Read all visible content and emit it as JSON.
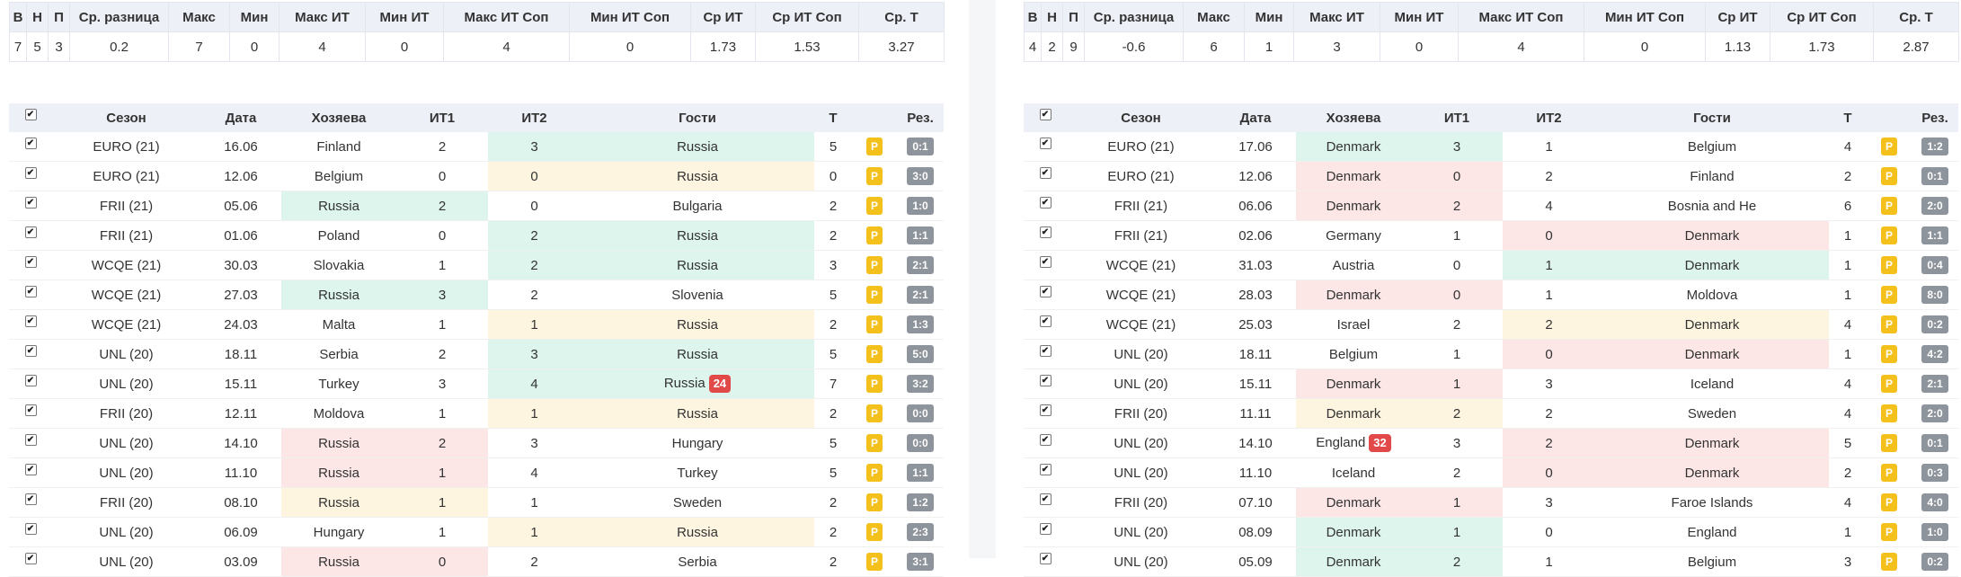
{
  "summary_headers": [
    "В",
    "Н",
    "П",
    "Ср. разница",
    "Макс",
    "Мин",
    "Макс ИТ",
    "Мин ИТ",
    "Макс ИТ Соп",
    "Мин ИТ Соп",
    "Ср ИТ",
    "Ср ИТ Соп",
    "Ср. Т"
  ],
  "match_headers": [
    "Сезон",
    "Дата",
    "Хозяева",
    "ИТ1",
    "ИТ2",
    "Гости",
    "Т",
    "Рез."
  ],
  "check_mark": "✔",
  "p_label": "P",
  "left": {
    "summary": [
      "7",
      "5",
      "3",
      "0.2",
      "7",
      "0",
      "4",
      "0",
      "4",
      "0",
      "1.73",
      "1.53",
      "3.27"
    ],
    "rows": [
      {
        "season": "EURO (21)",
        "date": "16.06",
        "home": "Finland",
        "it1": "2",
        "it2": "3",
        "away": "Russia",
        "t": "5",
        "res": "0:1",
        "hl": "away",
        "hc": "g"
      },
      {
        "season": "EURO (21)",
        "date": "12.06",
        "home": "Belgium",
        "it1": "0",
        "it2": "0",
        "away": "Russia",
        "t": "0",
        "res": "3:0",
        "hl": "away",
        "hc": "y"
      },
      {
        "season": "FRII (21)",
        "date": "05.06",
        "home": "Russia",
        "it1": "2",
        "it2": "0",
        "away": "Bulgaria",
        "t": "2",
        "res": "1:0",
        "hl": "home",
        "hc": "g"
      },
      {
        "season": "FRII (21)",
        "date": "01.06",
        "home": "Poland",
        "it1": "0",
        "it2": "2",
        "away": "Russia",
        "t": "2",
        "res": "1:1",
        "hl": "away",
        "hc": "g"
      },
      {
        "season": "WCQE (21)",
        "date": "30.03",
        "home": "Slovakia",
        "it1": "1",
        "it2": "2",
        "away": "Russia",
        "t": "3",
        "res": "2:1",
        "hl": "away",
        "hc": "g"
      },
      {
        "season": "WCQE (21)",
        "date": "27.03",
        "home": "Russia",
        "it1": "3",
        "it2": "2",
        "away": "Slovenia",
        "t": "5",
        "res": "2:1",
        "hl": "home",
        "hc": "g"
      },
      {
        "season": "WCQE (21)",
        "date": "24.03",
        "home": "Malta",
        "it1": "1",
        "it2": "1",
        "away": "Russia",
        "t": "2",
        "res": "1:3",
        "hl": "away",
        "hc": "y"
      },
      {
        "season": "UNL (20)",
        "date": "18.11",
        "home": "Serbia",
        "it1": "2",
        "it2": "3",
        "away": "Russia",
        "t": "5",
        "res": "5:0",
        "hl": "away",
        "hc": "g"
      },
      {
        "season": "UNL (20)",
        "date": "15.11",
        "home": "Turkey",
        "it1": "3",
        "it2": "4",
        "away": "Russia",
        "badge": "24",
        "t": "7",
        "res": "3:2",
        "hl": "away",
        "hc": "g"
      },
      {
        "season": "FRII (20)",
        "date": "12.11",
        "home": "Moldova",
        "it1": "1",
        "it2": "1",
        "away": "Russia",
        "t": "2",
        "res": "0:0",
        "hl": "away",
        "hc": "y"
      },
      {
        "season": "UNL (20)",
        "date": "14.10",
        "home": "Russia",
        "it1": "2",
        "it2": "3",
        "away": "Hungary",
        "t": "5",
        "res": "0:0",
        "hl": "home",
        "hc": "r"
      },
      {
        "season": "UNL (20)",
        "date": "11.10",
        "home": "Russia",
        "it1": "1",
        "it2": "4",
        "away": "Turkey",
        "t": "5",
        "res": "1:1",
        "hl": "home",
        "hc": "r"
      },
      {
        "season": "FRII (20)",
        "date": "08.10",
        "home": "Russia",
        "it1": "1",
        "it2": "1",
        "away": "Sweden",
        "t": "2",
        "res": "1:2",
        "hl": "home",
        "hc": "y"
      },
      {
        "season": "UNL (20)",
        "date": "06.09",
        "home": "Hungary",
        "it1": "1",
        "it2": "1",
        "away": "Russia",
        "t": "2",
        "res": "2:3",
        "hl": "away",
        "hc": "y"
      },
      {
        "season": "UNL (20)",
        "date": "03.09",
        "home": "Russia",
        "it1": "0",
        "it2": "2",
        "away": "Serbia",
        "t": "2",
        "res": "3:1",
        "hl": "home",
        "hc": "r"
      }
    ]
  },
  "right": {
    "summary": [
      "4",
      "2",
      "9",
      "-0.6",
      "6",
      "1",
      "3",
      "0",
      "4",
      "0",
      "1.13",
      "1.73",
      "2.87"
    ],
    "rows": [
      {
        "season": "EURO (21)",
        "date": "17.06",
        "home": "Denmark",
        "it1": "3",
        "it2": "1",
        "away": "Belgium",
        "t": "4",
        "res": "1:2",
        "hl": "home",
        "hc": "g"
      },
      {
        "season": "EURO (21)",
        "date": "12.06",
        "home": "Denmark",
        "it1": "0",
        "it2": "2",
        "away": "Finland",
        "t": "2",
        "res": "0:1",
        "hl": "home",
        "hc": "r"
      },
      {
        "season": "FRII (21)",
        "date": "06.06",
        "home": "Denmark",
        "it1": "2",
        "it2": "4",
        "away": "Bosnia and He",
        "t": "6",
        "res": "2:0",
        "hl": "home",
        "hc": "r"
      },
      {
        "season": "FRII (21)",
        "date": "02.06",
        "home": "Germany",
        "it1": "1",
        "it2": "0",
        "away": "Denmark",
        "t": "1",
        "res": "1:1",
        "hl": "away",
        "hc": "r"
      },
      {
        "season": "WCQE (21)",
        "date": "31.03",
        "home": "Austria",
        "it1": "0",
        "it2": "1",
        "away": "Denmark",
        "t": "1",
        "res": "0:4",
        "hl": "away",
        "hc": "g"
      },
      {
        "season": "WCQE (21)",
        "date": "28.03",
        "home": "Denmark",
        "it1": "0",
        "it2": "1",
        "away": "Moldova",
        "t": "1",
        "res": "8:0",
        "hl": "home",
        "hc": "r"
      },
      {
        "season": "WCQE (21)",
        "date": "25.03",
        "home": "Israel",
        "it1": "2",
        "it2": "2",
        "away": "Denmark",
        "t": "4",
        "res": "0:2",
        "hl": "away",
        "hc": "y"
      },
      {
        "season": "UNL (20)",
        "date": "18.11",
        "home": "Belgium",
        "it1": "1",
        "it2": "0",
        "away": "Denmark",
        "t": "1",
        "res": "4:2",
        "hl": "away",
        "hc": "r"
      },
      {
        "season": "UNL (20)",
        "date": "15.11",
        "home": "Denmark",
        "it1": "1",
        "it2": "3",
        "away": "Iceland",
        "t": "4",
        "res": "2:1",
        "hl": "home",
        "hc": "r"
      },
      {
        "season": "FRII (20)",
        "date": "11.11",
        "home": "Denmark",
        "it1": "2",
        "it2": "2",
        "away": "Sweden",
        "t": "4",
        "res": "2:0",
        "hl": "home",
        "hc": "y"
      },
      {
        "season": "UNL (20)",
        "date": "14.10",
        "home": "England",
        "homebadge": "32",
        "it1": "3",
        "it2": "2",
        "away": "Denmark",
        "t": "5",
        "res": "0:1",
        "hl": "away",
        "hc": "r"
      },
      {
        "season": "UNL (20)",
        "date": "11.10",
        "home": "Iceland",
        "it1": "2",
        "it2": "0",
        "away": "Denmark",
        "t": "2",
        "res": "0:3",
        "hl": "away",
        "hc": "r"
      },
      {
        "season": "FRII (20)",
        "date": "07.10",
        "home": "Denmark",
        "it1": "1",
        "it2": "3",
        "away": "Faroe Islands",
        "t": "4",
        "res": "4:0",
        "hl": "home",
        "hc": "r"
      },
      {
        "season": "UNL (20)",
        "date": "08.09",
        "home": "Denmark",
        "it1": "1",
        "it2": "0",
        "away": "England",
        "t": "1",
        "res": "1:0",
        "hl": "home",
        "hc": "g"
      },
      {
        "season": "UNL (20)",
        "date": "05.09",
        "home": "Denmark",
        "it1": "2",
        "it2": "1",
        "away": "Belgium",
        "t": "3",
        "res": "0:2",
        "hl": "home",
        "hc": "g"
      }
    ]
  }
}
